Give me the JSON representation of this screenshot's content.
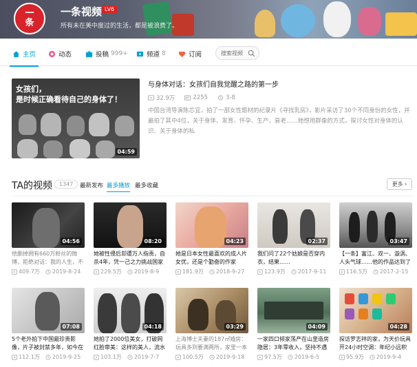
{
  "channel": {
    "avatar_lines": [
      "一",
      "条"
    ],
    "name": "一条视频",
    "level": "LV6",
    "slogan": "所有未在美中度过的生活，都是被浪费了。"
  },
  "nav": {
    "items": [
      {
        "label": "主页",
        "count": "",
        "icon": "home-icon",
        "active": true
      },
      {
        "label": "动态",
        "count": "",
        "icon": "feed-icon",
        "active": false
      },
      {
        "label": "投稿",
        "count": "999+",
        "icon": "upload-tv-icon",
        "active": false
      },
      {
        "label": "频道",
        "count": "8",
        "icon": "channel-icon",
        "active": false
      },
      {
        "label": "订阅",
        "count": "",
        "icon": "heart-icon",
        "active": false
      }
    ],
    "search_placeholder": "搜索视频"
  },
  "featured": {
    "caption_line1": "女孩们，",
    "caption_line2": "是时候正确看待自己的身体了！",
    "duration": "04:59",
    "title": "与身体对话：女孩们自我觉醒之路的第一步",
    "plays": "32.9万",
    "danmaku": "2255",
    "date": "3-8",
    "description": "中国台湾导演陈芯宜，拍了一部女性题材的纪录片《寻找乳房》，影片采访了30个不同身份的女性，并最拍了其中4位，关于身体、发育、怀孕、生产、衰老……她想用群像的方式，探讨女性对身体的认识、关于身体的私"
  },
  "videos_section": {
    "title": "TA的视频",
    "count": "1347",
    "sort_options": [
      {
        "label": "最新发布",
        "active": false
      },
      {
        "label": "最多播放",
        "active": true
      },
      {
        "label": "最多收藏",
        "active": false
      }
    ],
    "more_label": "更多"
  },
  "videos": [
    {
      "duration": "04:56",
      "title": "他删掉拥有660万粉丝的微博，拒绝对话：我的人生，不",
      "plays": "409.7万",
      "date": "2019-8-24",
      "gray": true
    },
    {
      "duration": "08:20",
      "title": "她被性侵后却遭万人指责，自杀4年，凭一己之力挑战国家",
      "plays": "229.5万",
      "date": "2019-8-9",
      "gray": false
    },
    {
      "duration": "04:23",
      "title": "她是日本女性最喜欢的成人片女优，还是个勤奋的作家",
      "plays": "181.9万",
      "date": "2018-9-27",
      "gray": false
    },
    {
      "duration": "02:37",
      "title": "我们问了22个姑娘是否穿内衣，结果……",
      "plays": "123.9万",
      "date": "2017-9-11",
      "gray": false
    },
    {
      "duration": "03:47",
      "title": "【一条】富江、双一、漩涡、人头气球……他的作品达到了",
      "plays": "116.5万",
      "date": "2017-2-15",
      "gray": false
    },
    {
      "duration": "07:08",
      "title": "5个老外拍下中国最珍贵影像，片子被封禁多年，如今在",
      "plays": "112.1万",
      "date": "2019-9-25",
      "gray": false
    },
    {
      "duration": "04:18",
      "title": "她拍了2000位美女，打破网红脸审美：这样的美人，流水线",
      "plays": "103.1万",
      "date": "2019-7-7",
      "gray": false
    },
    {
      "duration": "03:29",
      "title": "上海博士夫妻的187㎡婚房：玩具多到要满两所，家里一本",
      "plays": "100.5万",
      "date": "2019-9-18",
      "gray": true
    },
    {
      "duration": "04:09",
      "title": "一家四口倾家荡产在山里造房隐居：3年零收入，坚持不遇",
      "plays": "97.5万",
      "date": "2019-6-5",
      "gray": false
    },
    {
      "duration": "04:28",
      "title": "探访罗志祥的家，为天价玩具开24小时空调：年纪小远积不",
      "plays": "95.9万",
      "date": "2019-9-4",
      "gray": false
    }
  ]
}
